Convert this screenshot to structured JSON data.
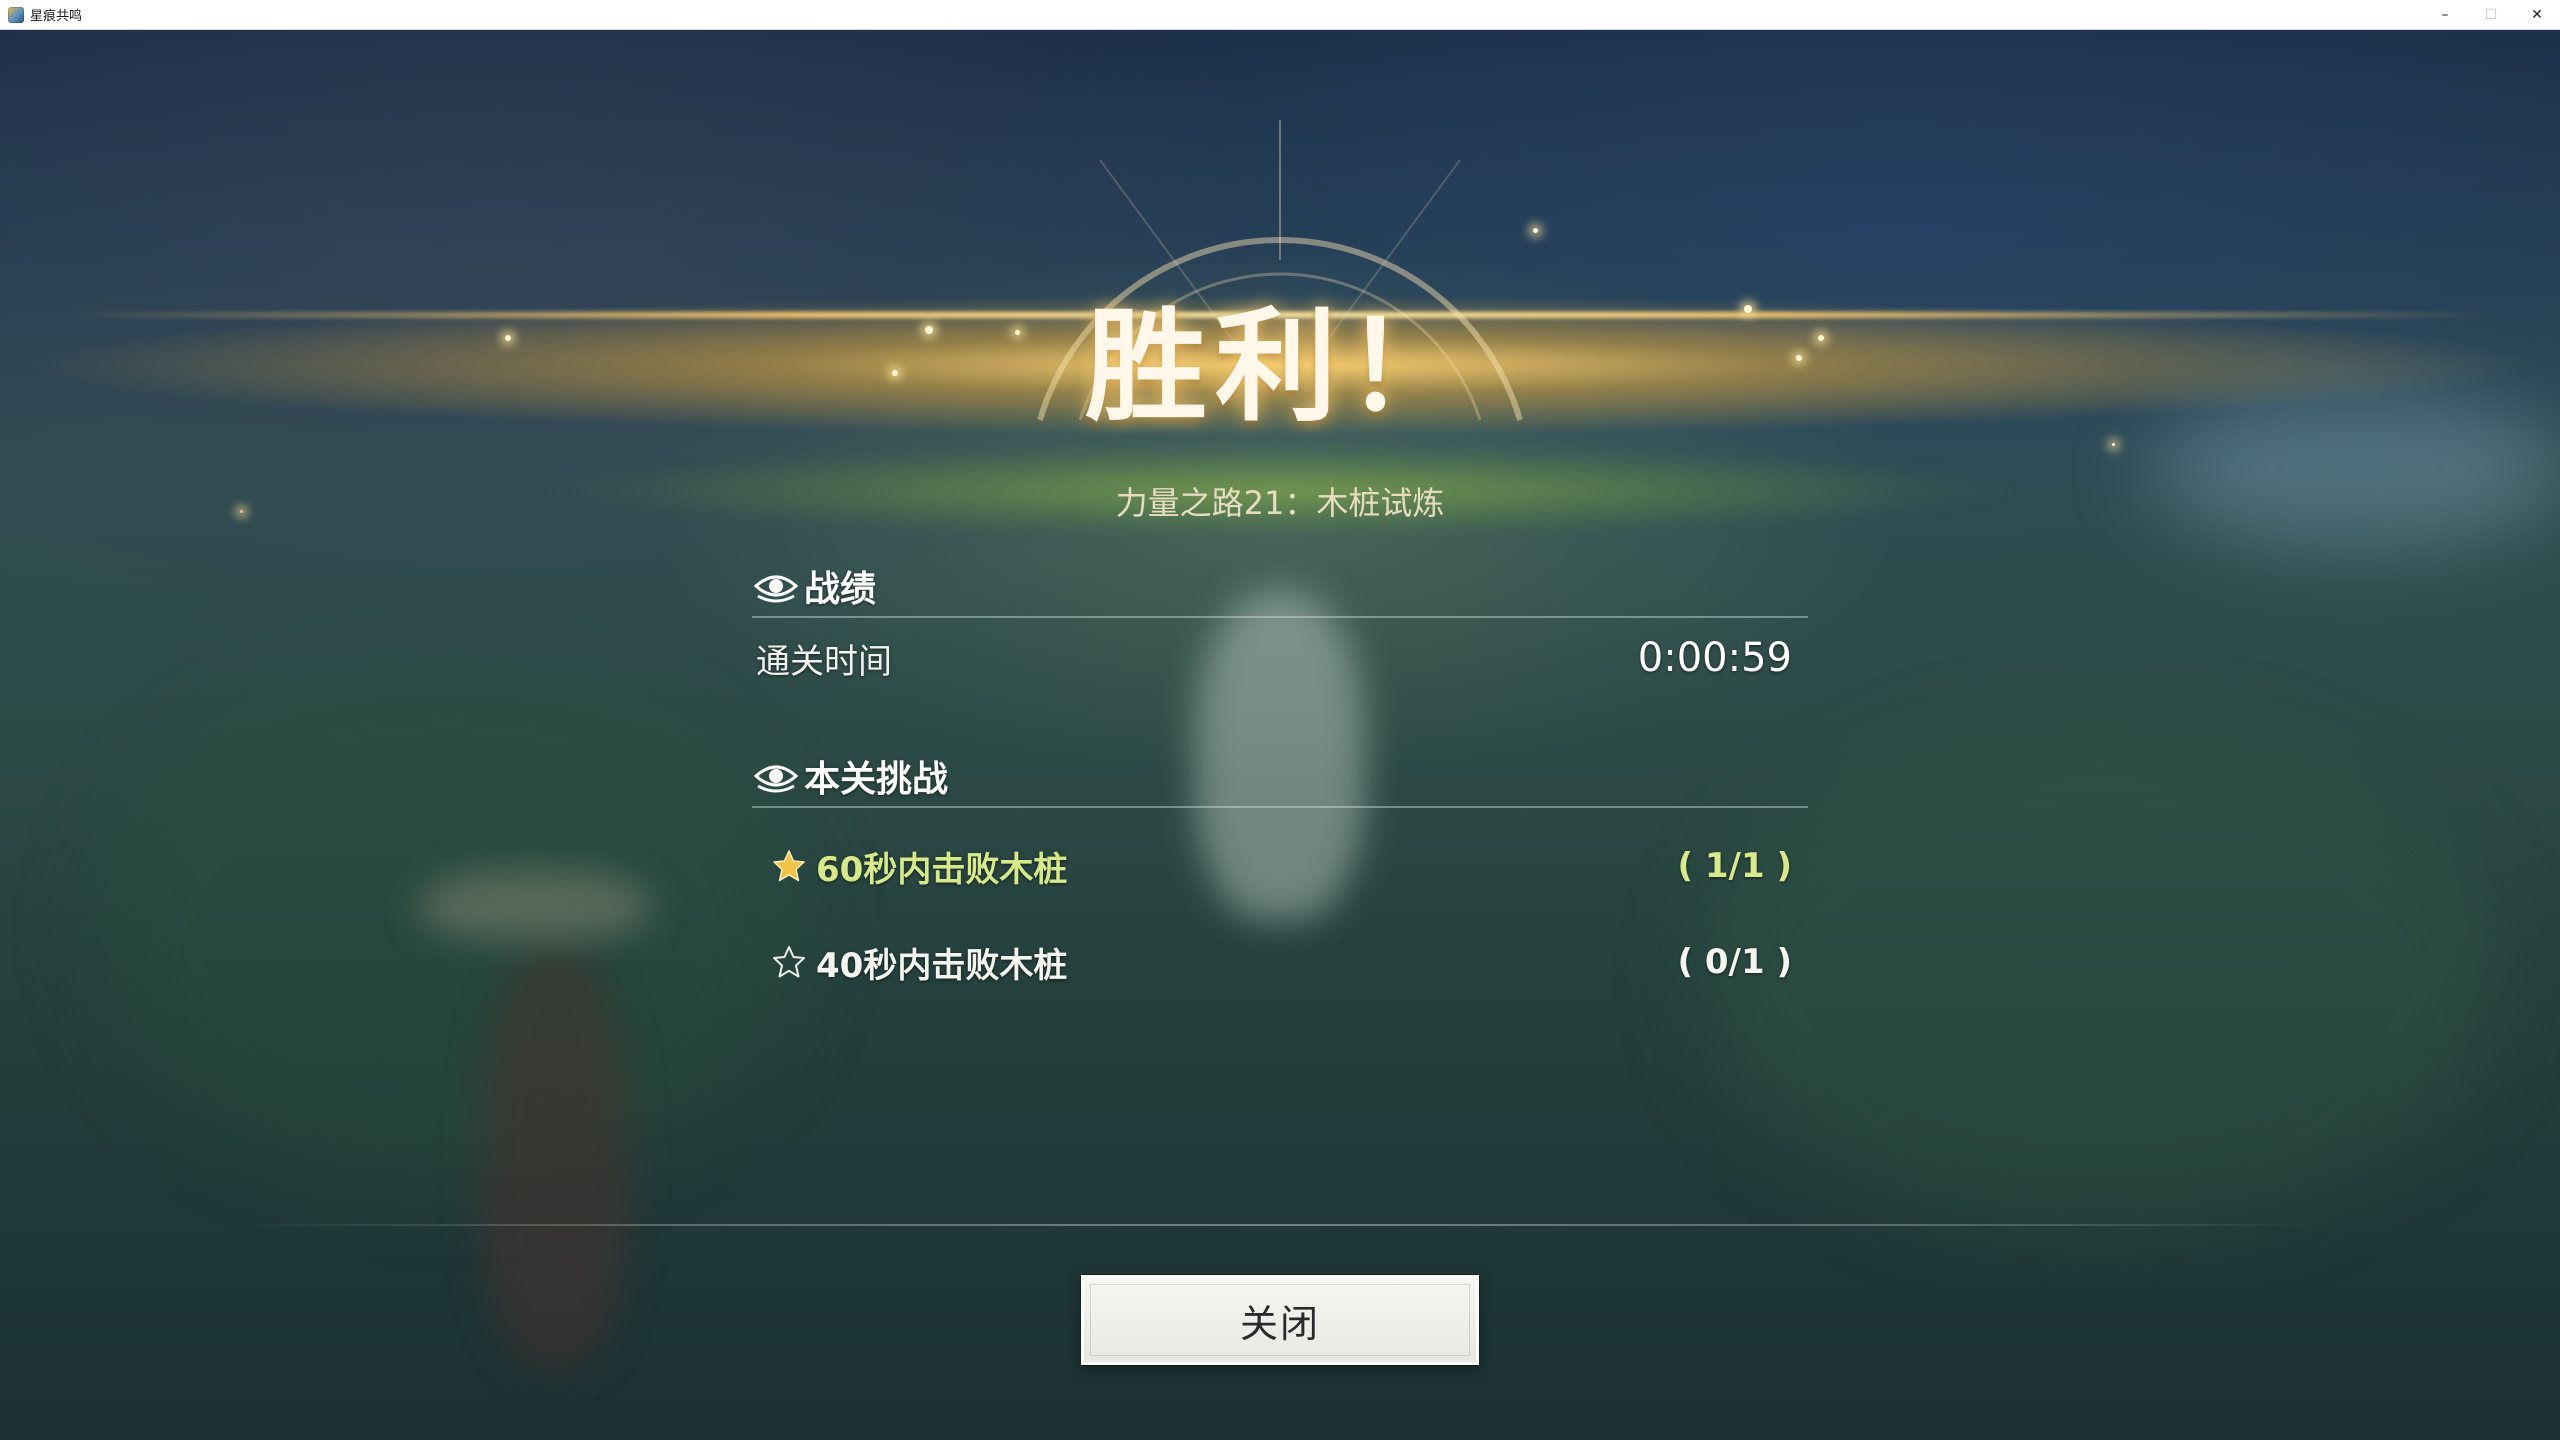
{
  "window": {
    "title": "星痕共鸣",
    "minimize_glyph": "–",
    "maximize_glyph": "☐",
    "close_glyph": "✕"
  },
  "result": {
    "title": "胜利！",
    "stage_name": "力量之路21：木桩试炼"
  },
  "record_section": {
    "header": "战绩",
    "icon": "eye-emblem-icon",
    "clear_time_label": "通关时间",
    "clear_time_value": "0:00:59"
  },
  "challenge_section": {
    "header": "本关挑战",
    "icon": "eye-emblem-icon",
    "items": [
      {
        "text": "60秒内击败木桩",
        "progress": "( 1/1 )",
        "completed": true,
        "icon": "star-filled-icon"
      },
      {
        "text": "40秒内击败木桩",
        "progress": "( 0/1 )",
        "completed": false,
        "icon": "star-outline-icon"
      }
    ]
  },
  "actions": {
    "close_label": "关闭"
  },
  "colors": {
    "completed_text": "#d8e98a",
    "star_gold": "#f1c24a",
    "title_glow": "#ffd278"
  }
}
